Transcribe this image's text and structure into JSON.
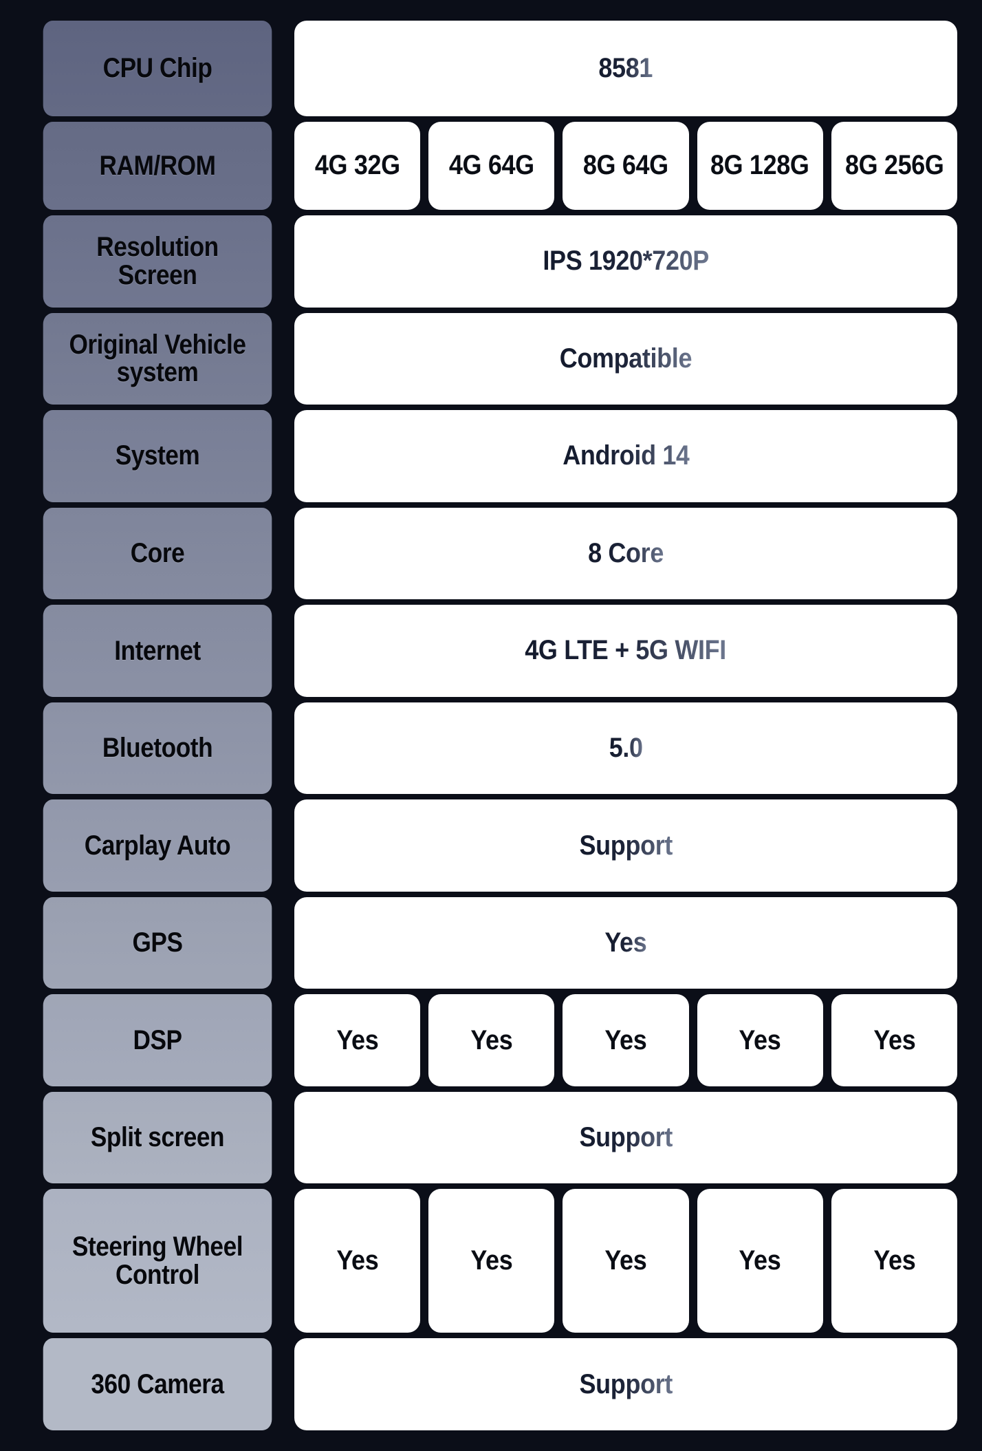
{
  "theme": {
    "background": "#0b0e18",
    "label_gradient_top": "#5e6480",
    "label_gradient_bottom": "#b3b9c6",
    "value_card_background": "#ffffff",
    "value_text_color": "#1b2237",
    "label_text_color": "#07080c"
  },
  "table": {
    "variant_count": 5,
    "rows": [
      {
        "label": "CPU Chip",
        "split": false,
        "values": [
          "8581"
        ]
      },
      {
        "label": "RAM/ROM",
        "split": true,
        "values": [
          "4G 32G",
          "4G 64G",
          "8G 64G",
          "8G 128G",
          "8G 256G"
        ]
      },
      {
        "label": "Resolution\nScreen",
        "split": false,
        "values": [
          "IPS 1920*720P"
        ]
      },
      {
        "label": "Original Vehicle\nsystem",
        "split": false,
        "values": [
          "Compatible"
        ]
      },
      {
        "label": "System",
        "split": false,
        "values": [
          "Android 14"
        ]
      },
      {
        "label": "Core",
        "split": false,
        "values": [
          "8 Core"
        ]
      },
      {
        "label": "Internet",
        "split": false,
        "values": [
          "4G LTE + 5G WIFI"
        ]
      },
      {
        "label": "Bluetooth",
        "split": false,
        "values": [
          "5.0"
        ]
      },
      {
        "label": "Carplay Auto",
        "split": false,
        "values": [
          "Support"
        ]
      },
      {
        "label": "GPS",
        "split": false,
        "values": [
          "Yes"
        ]
      },
      {
        "label": "DSP",
        "split": true,
        "values": [
          "Yes",
          "Yes",
          "Yes",
          "Yes",
          "Yes"
        ]
      },
      {
        "label": "Split screen",
        "split": false,
        "values": [
          "Support"
        ]
      },
      {
        "label": "Steering Wheel\nControl",
        "split": true,
        "values": [
          "Yes",
          "Yes",
          "Yes",
          "Yes",
          "Yes"
        ]
      },
      {
        "label": "360 Camera",
        "split": false,
        "values": [
          "Support"
        ]
      }
    ]
  }
}
